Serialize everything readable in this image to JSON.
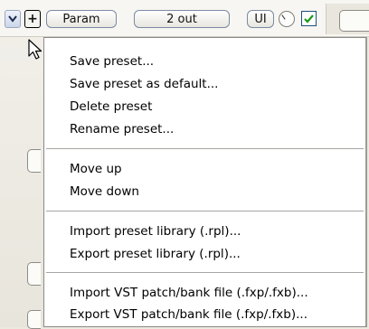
{
  "toolbar": {
    "param_label": "Param",
    "out_label": "2 out",
    "ui_label": "UI",
    "plus_symbol": "+",
    "enabled_checkbox": true
  },
  "menu": {
    "items": [
      {
        "label": "Save preset..."
      },
      {
        "label": "Save preset as default..."
      },
      {
        "label": "Delete preset"
      },
      {
        "label": "Rename preset..."
      },
      {
        "label": "Move up"
      },
      {
        "label": "Move down"
      },
      {
        "label": "Import preset library (.rpl)..."
      },
      {
        "label": "Export preset library (.rpl)..."
      },
      {
        "label": "Import VST patch/bank file (.fxp/.fxb)..."
      },
      {
        "label": "Export VST patch/bank file (.fxp/.fxb)..."
      }
    ]
  },
  "colors": {
    "menu_background": "#ffffff",
    "checkbox_border": "#1c5180",
    "checkmark": "#1a9a1a"
  },
  "icons": [
    "chevron-down-icon",
    "plus-icon",
    "knob-icon",
    "checkmark-icon",
    "mouse-cursor-icon"
  ]
}
